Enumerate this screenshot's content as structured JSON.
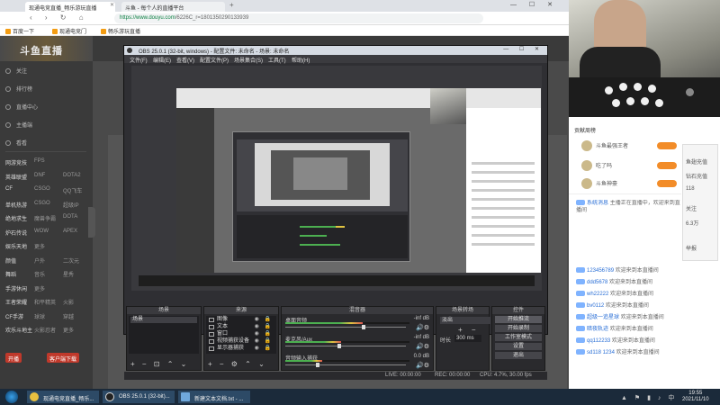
{
  "browser": {
    "tabs": [
      {
        "label": "现通电竞直播_畅乐游玩直播"
      },
      {
        "label": "斗鱼 - 每个人的直播平台"
      }
    ],
    "url_main": "https://www.douyu.com",
    "url_rest": "/6226C_r=1801350290133939",
    "bookmarks": [
      "百度一下",
      "现通电竞门",
      "畅乐游玩直播"
    ]
  },
  "sidebar": {
    "logo": "斗鱼直播",
    "items": [
      "关注",
      "排行榜",
      "直播中心",
      "主播端",
      "看看"
    ],
    "grid": [
      [
        "网游竞技",
        "FPS"
      ],
      [
        "英雄联盟",
        "DNF",
        "DOTA2"
      ],
      [
        "CF",
        "CSGO",
        "QQ飞车"
      ],
      [
        "单机热游",
        "CSGO",
        "超级IP"
      ],
      [
        "绝地求生",
        "魔兽争霸",
        "DOTA"
      ],
      [
        "炉石传说",
        "WOW",
        "APEX"
      ],
      [
        "娱乐天地",
        "更多"
      ],
      [
        "颜值",
        "户外",
        "二次元"
      ],
      [
        "舞蹈",
        "音乐",
        "星秀"
      ],
      [
        "手游休闲",
        "更多"
      ],
      [
        "王者荣耀",
        "和平精英",
        "火影"
      ],
      [
        "CF手游",
        "球球",
        "穿越"
      ],
      [
        "欢乐斗地主",
        "火影忍者",
        "更多"
      ]
    ],
    "btn_left": "开播",
    "btn_right": "客户端下载"
  },
  "chat": {
    "rank_title": "贡献周榜",
    "rank": [
      "斗鱼最强王者",
      "吃了吗",
      "斗鱼神豪"
    ],
    "messages": [
      {
        "user": "系统消息",
        "text": "主播正在直播中，欢迎来到直播间"
      },
      {
        "user": "123456789",
        "text": "欢迎来到本直播间"
      },
      {
        "user": "ddd5678",
        "text": "欢迎来到本直播间"
      },
      {
        "user": "wh22222",
        "text": "欢迎来到本直播间"
      },
      {
        "user": "bv0112",
        "text": "欢迎来到本直播间"
      },
      {
        "user": "超级一追星球",
        "text": "欢迎来到本直播间"
      },
      {
        "user": "暗夜轨迹",
        "text": "欢迎来到本直播间"
      },
      {
        "user": "qq112233",
        "text": "欢迎来到本直播间"
      },
      {
        "user": "sd118 1234",
        "text": "欢迎来到本直播间"
      }
    ],
    "widget": [
      "鱼翅充值",
      "钻石充值",
      "118",
      "关注",
      "6.3万",
      "举报"
    ]
  },
  "obs": {
    "title": "OBS 25.0.1 (32-bit, windows) - 配置文件: 未命名 - 场景: 未命名",
    "menu": [
      "文件(F)",
      "编辑(E)",
      "查看(V)",
      "配置文件(P)",
      "场景集合(S)",
      "工具(T)",
      "帮助(H)"
    ],
    "docks": {
      "scenes": "场景",
      "sources": "来源",
      "mixer": "混音器",
      "transitions": "场景转场",
      "controls": "控件"
    },
    "scene_items": [
      "场景"
    ],
    "sources": [
      "图像",
      "文本",
      "窗口",
      "视频捕获设备",
      "显示器捕获"
    ],
    "mixer": [
      {
        "name": "桌面音频",
        "db": "-inf dB",
        "level": 0.62
      },
      {
        "name": "麦克风/Aux",
        "db": "-inf dB",
        "level": 0.45
      },
      {
        "name": "音频输入捕获",
        "db": "0.0 dB",
        "level": 0.3
      }
    ],
    "transition": "淡出",
    "duration_label": "时长",
    "duration": "300 ms",
    "controls": [
      "开始推流",
      "开始录制",
      "工作室模式",
      "设置",
      "退出"
    ],
    "status": {
      "live": "LIVE: 00:00:00",
      "rec": "REC: 00:00:00",
      "cpu": "CPU: 4.7%, 30.00 fps"
    }
  },
  "taskbar": {
    "tasks": [
      "现通电竞直播_畅乐...",
      "OBS 25.0.1 (32-bit)...",
      "新建文本文档.txt - ..."
    ],
    "time": "19:55",
    "date": "2021/11/10"
  }
}
